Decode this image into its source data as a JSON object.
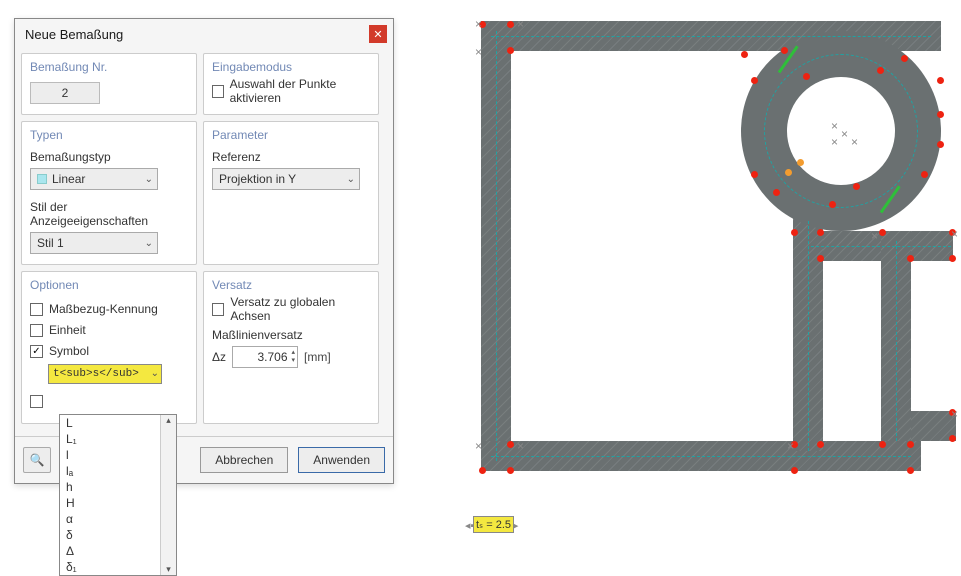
{
  "dialog": {
    "title": "Neue Bemaßung",
    "bemassung_nr": {
      "heading": "Bemaßung Nr.",
      "value": "2"
    },
    "eingabemodus": {
      "heading": "Eingabemodus",
      "checkbox_label": "Auswahl der Punkte aktivieren",
      "checked": false
    },
    "typen": {
      "heading": "Typen",
      "bemassungstyp_label": "Bemaßungstyp",
      "bemassungstyp_value": "Linear",
      "stil_label": "Stil der Anzeigeeigenschaften",
      "stil_value": "Stil 1"
    },
    "parameter": {
      "heading": "Parameter",
      "referenz_label": "Referenz",
      "referenz_value": "Projektion in Y"
    },
    "optionen": {
      "heading": "Optionen",
      "massbezug_label": "Maßbezug-Kennung",
      "massbezug_checked": false,
      "einheit_label": "Einheit",
      "einheit_checked": false,
      "symbol_label": "Symbol",
      "symbol_checked": true,
      "symbol_value": "t<sub>s</sub>",
      "extra_checked": false
    },
    "versatz": {
      "heading": "Versatz",
      "globale_label": "Versatz zu globalen Achsen",
      "globale_checked": false,
      "masslinien_label": "Maßlinienversatz",
      "delta_label": "Δz",
      "delta_value": "3.706",
      "unit": "[mm]"
    },
    "dropdown_items": [
      "L",
      "L₁",
      "l",
      "lₐ",
      "h",
      "H",
      "α",
      "δ",
      "Δ",
      "δ₁"
    ],
    "buttons": {
      "cancel": "Abbrechen",
      "apply": "Anwenden"
    }
  },
  "canvas": {
    "dim_label": "tₛ = 2.5"
  }
}
